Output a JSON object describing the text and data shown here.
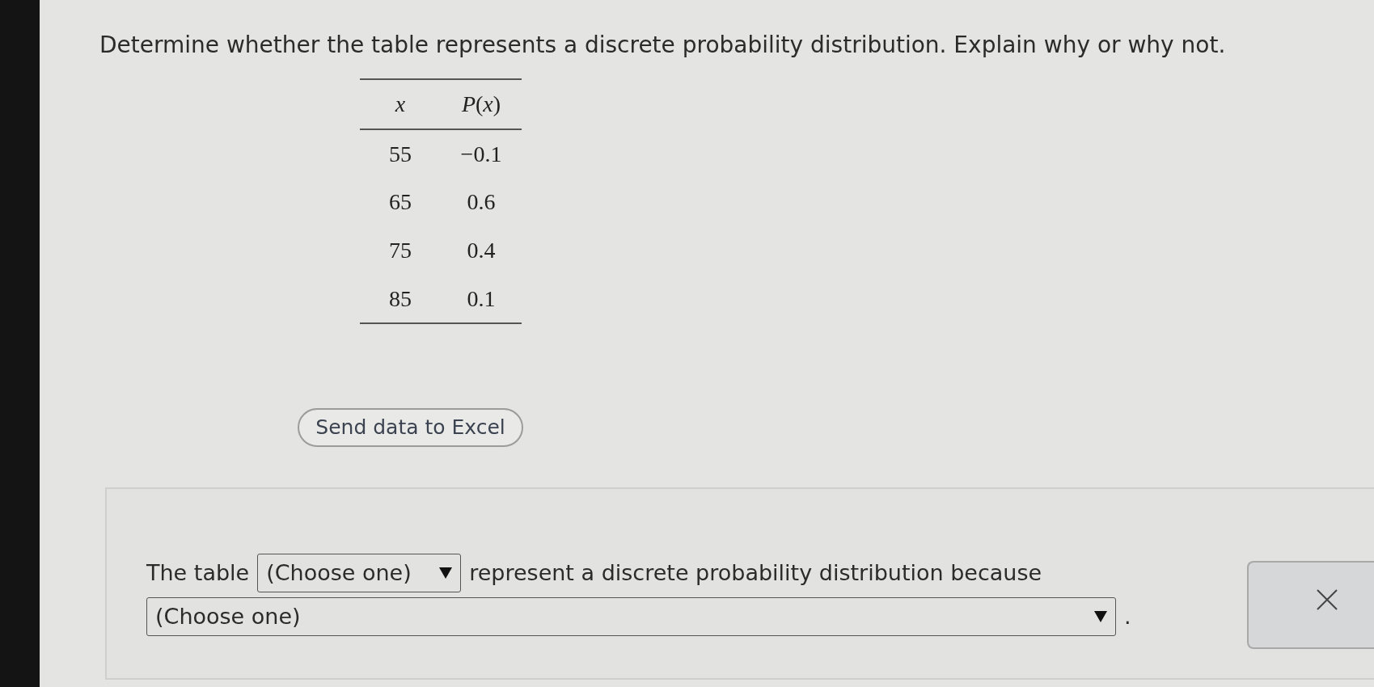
{
  "question": "Determine whether the table represents a discrete probability distribution. Explain why or why not.",
  "table": {
    "columns": [
      "x",
      "*P*(*x*)"
    ],
    "rows": [
      [
        "55",
        "−0.1"
      ],
      [
        "65",
        "0.6"
      ],
      [
        "75",
        "0.4"
      ],
      [
        "85",
        "0.1"
      ]
    ]
  },
  "send_button": "Send data to Excel",
  "answer": {
    "lines": [
      [
        {
          "kind": "text",
          "text": "The table"
        },
        {
          "kind": "dropdown",
          "value": "(Choose one)"
        },
        {
          "kind": "text",
          "text": "represent a discrete probability distribution because"
        }
      ],
      [
        {
          "kind": "dropdown",
          "value": "(Choose one)"
        },
        {
          "kind": "text",
          "text": "."
        }
      ]
    ]
  }
}
